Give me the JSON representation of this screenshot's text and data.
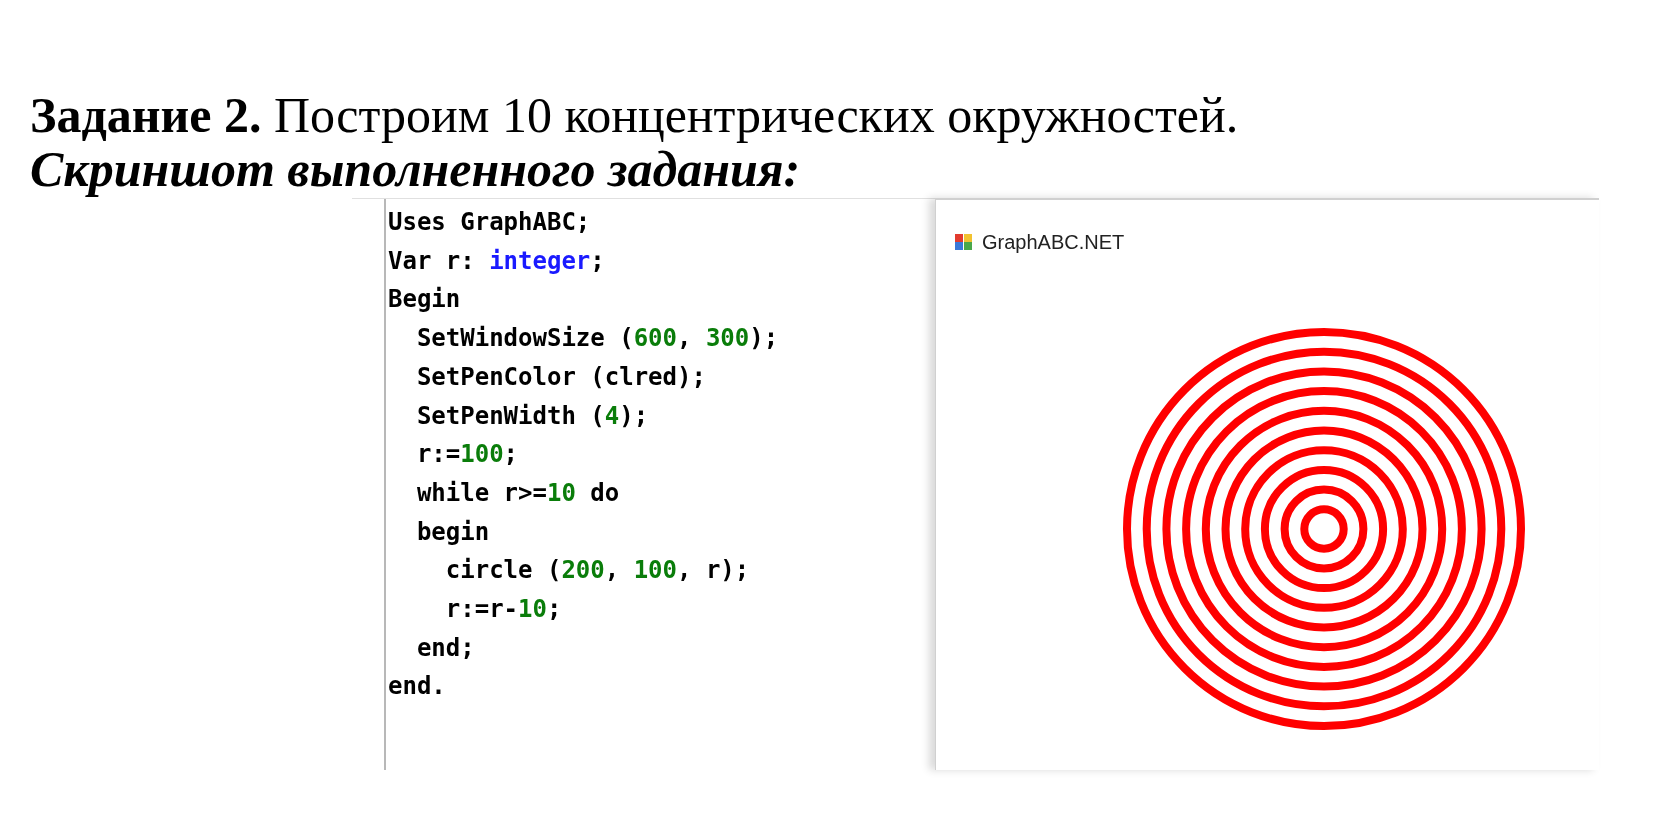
{
  "heading": {
    "label": "Задание 2.",
    "text": "Построим 10 концентрических окружностей."
  },
  "subheading": "Скриншот выполненного задания:",
  "code_lines": [
    {
      "tokens": [
        {
          "text": "Uses",
          "kind": "keyword"
        },
        {
          "text": " GraphABC;",
          "kind": "text"
        }
      ]
    },
    {
      "tokens": [
        {
          "text": "Var",
          "kind": "keyword"
        },
        {
          "text": " r: ",
          "kind": "text"
        },
        {
          "text": "integer",
          "kind": "type"
        },
        {
          "text": ";",
          "kind": "text"
        }
      ]
    },
    {
      "tokens": [
        {
          "text": "Begin",
          "kind": "keyword"
        }
      ]
    },
    {
      "tokens": [
        {
          "text": "  SetWindowSize (",
          "kind": "text"
        },
        {
          "text": "600",
          "kind": "number"
        },
        {
          "text": ", ",
          "kind": "text"
        },
        {
          "text": "300",
          "kind": "number"
        },
        {
          "text": ");",
          "kind": "text"
        }
      ]
    },
    {
      "tokens": [
        {
          "text": "  SetPenColor (clred);",
          "kind": "text"
        }
      ]
    },
    {
      "tokens": [
        {
          "text": "  SetPenWidth (",
          "kind": "text"
        },
        {
          "text": "4",
          "kind": "number"
        },
        {
          "text": ");",
          "kind": "text"
        }
      ]
    },
    {
      "tokens": [
        {
          "text": "  r:=",
          "kind": "text"
        },
        {
          "text": "100",
          "kind": "number"
        },
        {
          "text": ";",
          "kind": "text"
        }
      ]
    },
    {
      "tokens": [
        {
          "text": "  while",
          "kind": "keyword"
        },
        {
          "text": " r>=",
          "kind": "text"
        },
        {
          "text": "10",
          "kind": "number"
        },
        {
          "text": " do",
          "kind": "keyword"
        }
      ]
    },
    {
      "tokens": [
        {
          "text": "  begin",
          "kind": "keyword"
        }
      ]
    },
    {
      "tokens": [
        {
          "text": "    circle (",
          "kind": "text"
        },
        {
          "text": "200",
          "kind": "number"
        },
        {
          "text": ", ",
          "kind": "text"
        },
        {
          "text": "100",
          "kind": "number"
        },
        {
          "text": ", r);",
          "kind": "text"
        }
      ]
    },
    {
      "tokens": [
        {
          "text": "    r:=r-",
          "kind": "text"
        },
        {
          "text": "10",
          "kind": "number"
        },
        {
          "text": ";",
          "kind": "text"
        }
      ]
    },
    {
      "tokens": [
        {
          "text": "  end",
          "kind": "keyword"
        },
        {
          "text": ";",
          "kind": "text"
        }
      ]
    },
    {
      "tokens": [
        {
          "text": "end",
          "kind": "keyword"
        },
        {
          "text": ".",
          "kind": "text"
        }
      ]
    }
  ],
  "window": {
    "title": "GraphABC.NET"
  }
}
